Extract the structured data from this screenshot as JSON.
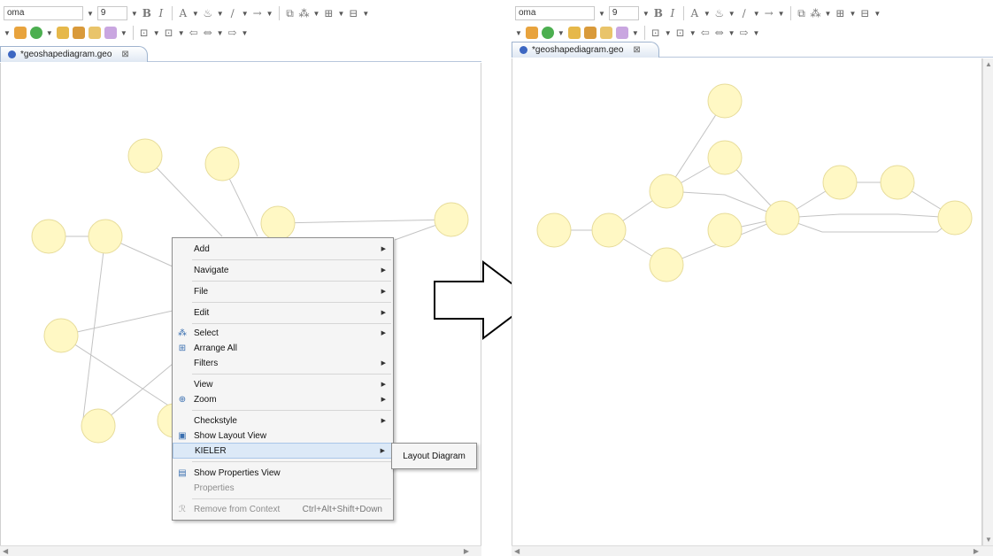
{
  "toolbar": {
    "font_name": "oma",
    "font_size": "9",
    "right_font_name": "oma"
  },
  "editor": {
    "tab_title": "*geoshapediagram.geo",
    "right_tab_title": "*geoshapediagram.geo"
  },
  "context_menu": {
    "items": [
      {
        "label": "Add"
      },
      {
        "label": "Navigate"
      },
      {
        "label": "File"
      },
      {
        "label": "Edit"
      },
      {
        "label": "Select"
      },
      {
        "label": "Arrange All"
      },
      {
        "label": "Filters"
      },
      {
        "label": "View"
      },
      {
        "label": "Zoom"
      },
      {
        "label": "Checkstyle"
      },
      {
        "label": "Show Layout View"
      },
      {
        "label": "KIELER"
      },
      {
        "label": "Show Properties View"
      },
      {
        "label": "Properties"
      },
      {
        "label": "Remove from Context",
        "accelerator": "Ctrl+Alt+Shift+Down"
      }
    ]
  },
  "submenu": {
    "label": "Layout Diagram"
  },
  "colors": {
    "node_fill": "#fff8c4",
    "node_stroke": "#e7dc9a",
    "edge": "#c3c3c3",
    "menu_highlight": "#dce9f7"
  }
}
